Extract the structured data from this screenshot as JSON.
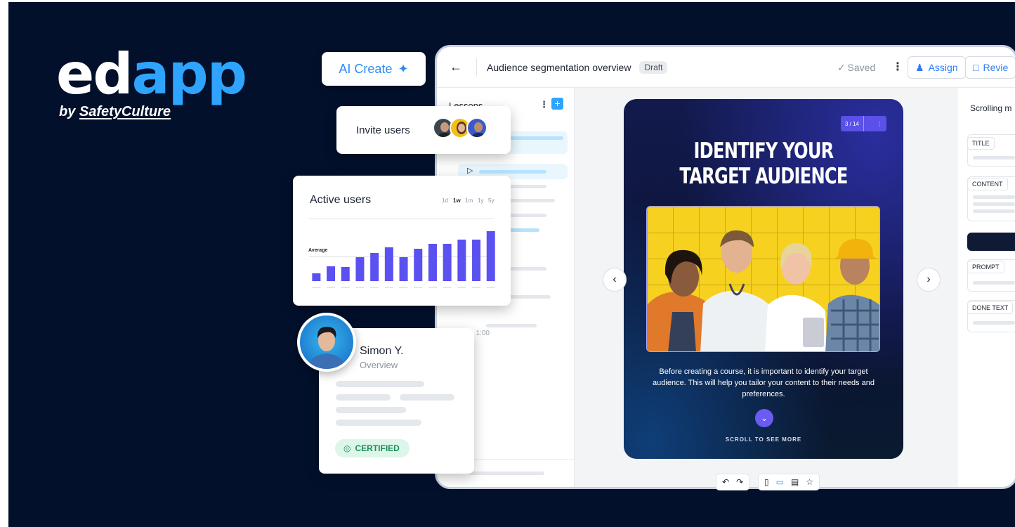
{
  "brand": {
    "logo_part1": "ed",
    "logo_part2": "app",
    "by": "by ",
    "company": "SafetyCulture"
  },
  "ai_create": {
    "label": "AI Create",
    "icon": "sparkles-icon"
  },
  "invite": {
    "label": "Invite users"
  },
  "active_users": {
    "title": "Active users",
    "ranges": [
      "1d",
      "1w",
      "1m",
      "1y",
      "5y"
    ],
    "selected_range": "1w",
    "average_label": "Average"
  },
  "chart_data": {
    "type": "bar",
    "title": "Active users",
    "categories": [
      "",
      "",
      "",
      "",
      "",
      "",
      "",
      "",
      "",
      "",
      "",
      "",
      ""
    ],
    "values": [
      11,
      21,
      20,
      34,
      40,
      48,
      34,
      46,
      53,
      53,
      59,
      59,
      71
    ],
    "ylim": [
      0,
      80
    ],
    "reference_line": {
      "label": "Average",
      "value": 35
    },
    "grid": false,
    "color": "#5b50f0"
  },
  "profile": {
    "name": "Simon Y.",
    "subtitle": "Overview",
    "badge": "CERTIFIED"
  },
  "app": {
    "back_icon": "arrow-left-icon",
    "title": "Audience segmentation overview",
    "status": "Draft",
    "saved": "Saved",
    "assign": "Assign",
    "review": "Revie",
    "lessons_title": "Lessons",
    "duration": "1:00"
  },
  "slide": {
    "counter": "3 / 14",
    "heading_line1": "IDENTIFY YOUR",
    "heading_line2": "TARGET AUDIENCE",
    "body": "Before creating a course, it is important to identify your target audience. This will help you tailor your content to their needs and preferences.",
    "scroll_more": "SCROLL TO SEE MORE"
  },
  "right_panel": {
    "title": "Scrolling m",
    "fields": [
      "TITLE",
      "CONTENT",
      "PROMPT",
      "DONE TEXT"
    ],
    "add_label": "+"
  },
  "colors": {
    "background": "#02102b",
    "brand_blue": "#2fa4ff",
    "accent_purple": "#5b50f0",
    "certified_green": "#1e8c58"
  }
}
